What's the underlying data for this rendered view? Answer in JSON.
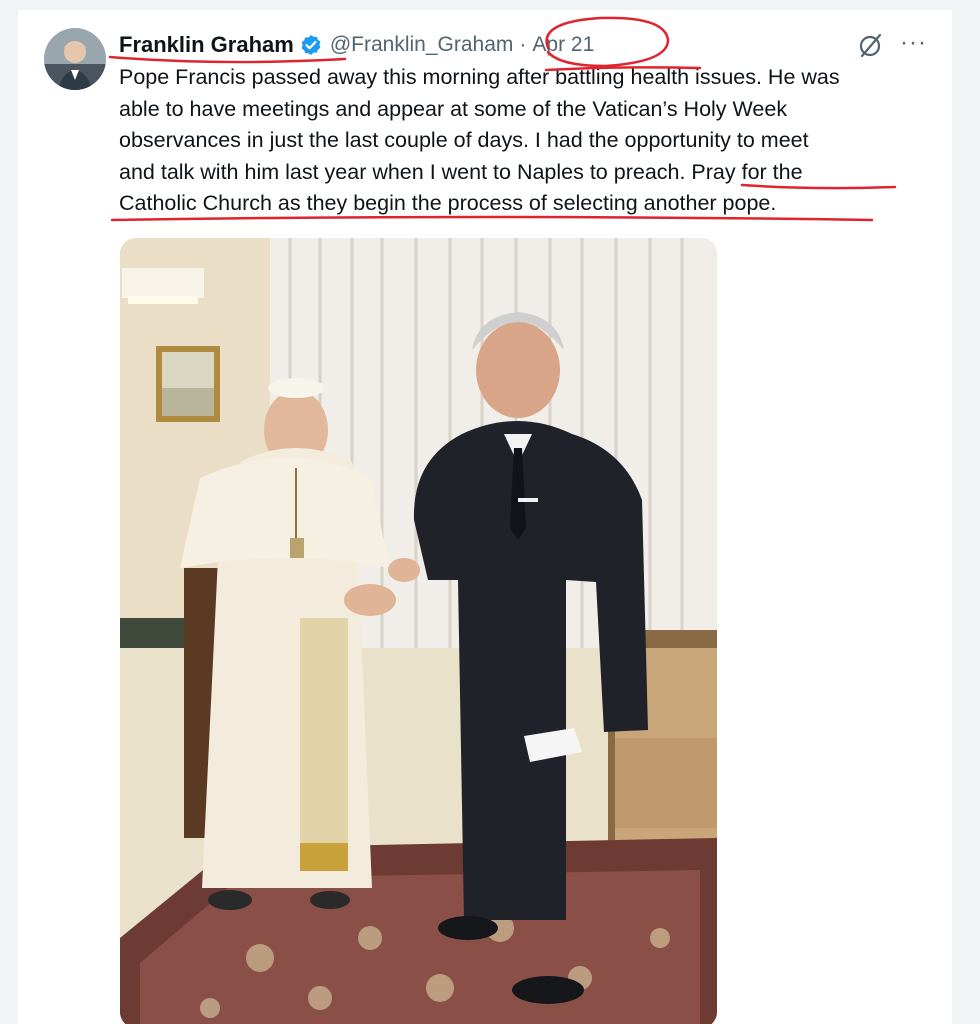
{
  "tweet": {
    "author": {
      "display_name": "Franklin Graham",
      "handle": "@Franklin_Graham",
      "verified": true,
      "avatar_icon": "profile-photo"
    },
    "separator": "·",
    "date": "Apr 21",
    "text_lines": [
      "Pope Francis passed away this morning after battling health issues. He was",
      "able to have meetings and appear at some of the Vatican’s Holy Week",
      "observances in just the last couple of days. I had the opportunity to meet",
      "and talk with him last year when I went to Naples to preach. Pray for the",
      "Catholic Church as they begin the process of selecting another pope."
    ],
    "actions": {
      "grok_icon": "grok-slash-icon",
      "more_icon": "more-icon",
      "more_label": "···"
    },
    "media": {
      "type": "photo"
    }
  },
  "colors": {
    "primary_text": "#0f1419",
    "secondary_text": "#536471",
    "verified_blue": "#1d9bf0",
    "annotation_red": "#e0242f"
  }
}
